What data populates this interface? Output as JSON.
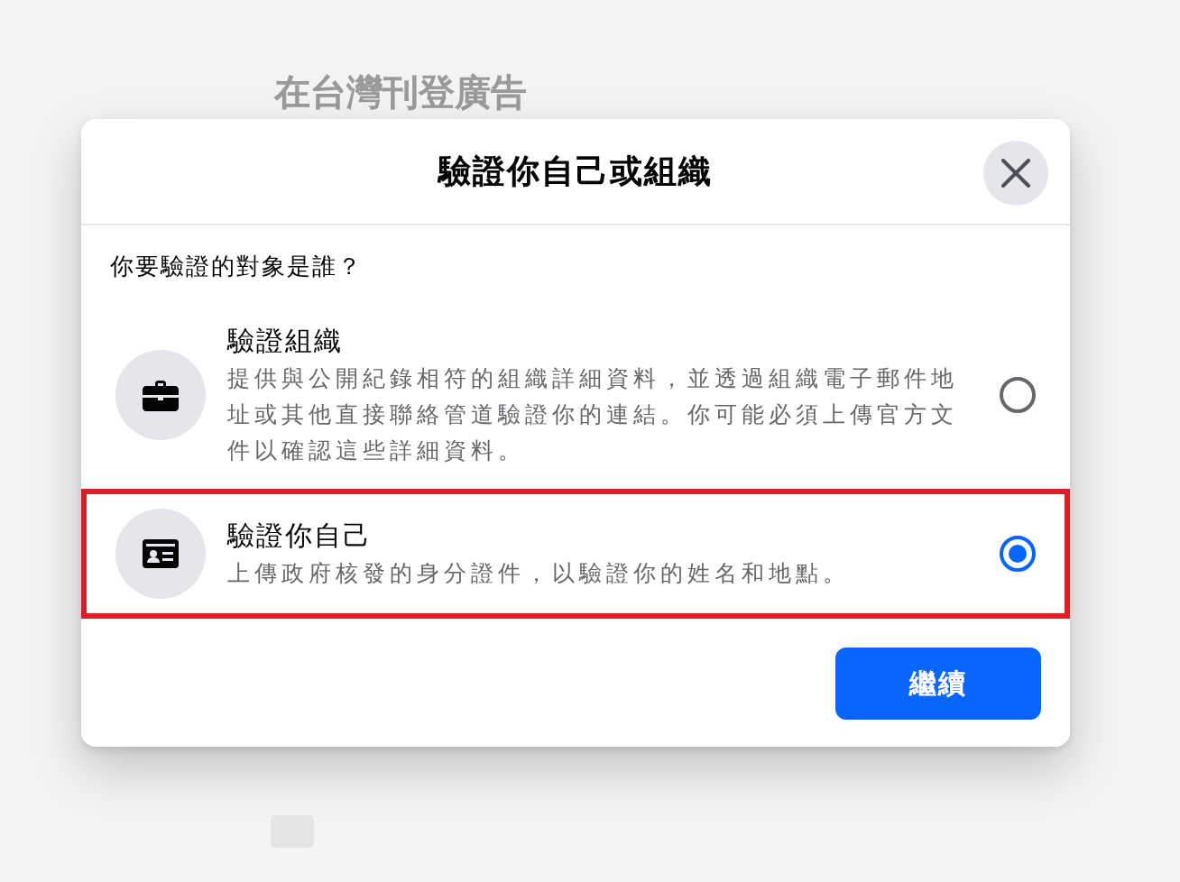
{
  "background": {
    "title": "在台灣刊登廣告"
  },
  "dialog": {
    "title": "驗證你自己或組織",
    "question": "你要驗證的對象是誰？",
    "options": [
      {
        "kind": "organization",
        "title": "驗證組織",
        "description": "提供與公開紀錄相符的組織詳細資料，並透過組織電子郵件地址或其他直接聯絡管道驗證你的連結。你可能必須上傳官方文件以確認這些詳細資料。",
        "selected": false
      },
      {
        "kind": "person",
        "title": "驗證你自己",
        "description": "上傳政府核發的身分證件，以驗證你的姓名和地點。",
        "selected": true
      }
    ],
    "buttons": [
      "繼續"
    ]
  }
}
